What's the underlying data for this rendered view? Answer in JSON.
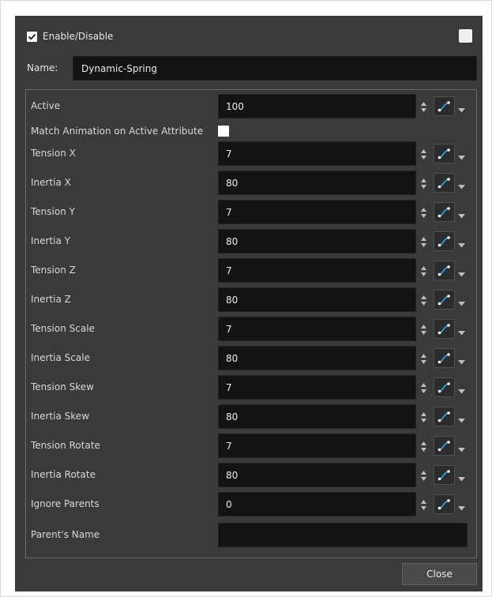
{
  "header": {
    "enable_label": "Enable/Disable",
    "enable_checked": true,
    "name_label": "Name:",
    "name_value": "Dynamic-Spring"
  },
  "attributes": [
    {
      "label": "Active",
      "value": "100"
    },
    {
      "label": "Match Animation on Active Attribute",
      "checked": false
    },
    {
      "label": "Tension X",
      "value": "7"
    },
    {
      "label": "Inertia X",
      "value": "80"
    },
    {
      "label": "Tension Y",
      "value": "7"
    },
    {
      "label": "Inertia Y",
      "value": "80"
    },
    {
      "label": "Tension Z",
      "value": "7"
    },
    {
      "label": "Inertia Z",
      "value": "80"
    },
    {
      "label": "Tension Scale",
      "value": "7"
    },
    {
      "label": "Inertia Scale",
      "value": "80"
    },
    {
      "label": "Tension Skew",
      "value": "7"
    },
    {
      "label": "Inertia Skew",
      "value": "80"
    },
    {
      "label": "Tension Rotate",
      "value": "7"
    },
    {
      "label": "Inertia Rotate",
      "value": "80"
    },
    {
      "label": "Ignore Parents",
      "value": "0"
    },
    {
      "label": "Parent's Name",
      "value": ""
    }
  ],
  "footer": {
    "close_label": "Close"
  },
  "colors": {
    "panel_bg": "#3a3a3a",
    "field_bg": "#131313",
    "function_icon": "#2ea8e6"
  },
  "icons": {
    "spin": "up-down-arrows-icon",
    "function": "function-curve-icon",
    "menu": "dropdown-arrow-icon"
  }
}
